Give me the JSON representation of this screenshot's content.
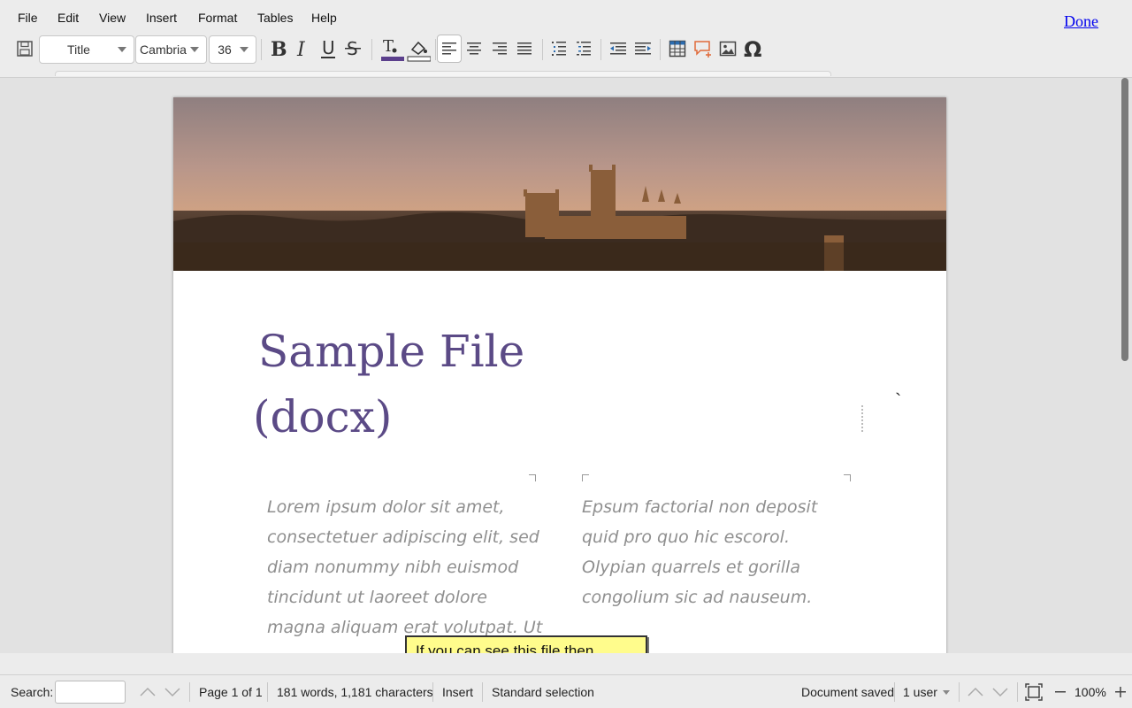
{
  "menu": {
    "items": [
      "File",
      "Edit",
      "View",
      "Insert",
      "Format",
      "Tables",
      "Help"
    ],
    "done_label": "Done"
  },
  "toolbar": {
    "style_value": "Title",
    "font_value": "Cambria",
    "size_value": "36",
    "font_color": "#5b3f8c"
  },
  "document": {
    "title_line1": "Sample File",
    "title_line2": "(docx)",
    "column1": "Lorem ipsum dolor sit amet, consectetuer adipiscing elit, sed diam nonummy nibh euismod tincidunt ut laoreet dolore magna aliquam erat volutpat. Ut",
    "column2": "Epsum factorial non deposit quid pro quo hic escorol. Olypian quarrels et gorilla congolium sic ad nauseum.",
    "note_text": "If you can see this file then",
    "stray_mark": "`"
  },
  "status": {
    "search_label": "Search:",
    "search_value": "",
    "page_info": "Page 1 of 1",
    "word_count": "181 words, 1,181 characters",
    "mode": "Insert",
    "selection": "Standard selection",
    "saved": "Document saved",
    "users": "1 user",
    "zoom": "100%"
  }
}
